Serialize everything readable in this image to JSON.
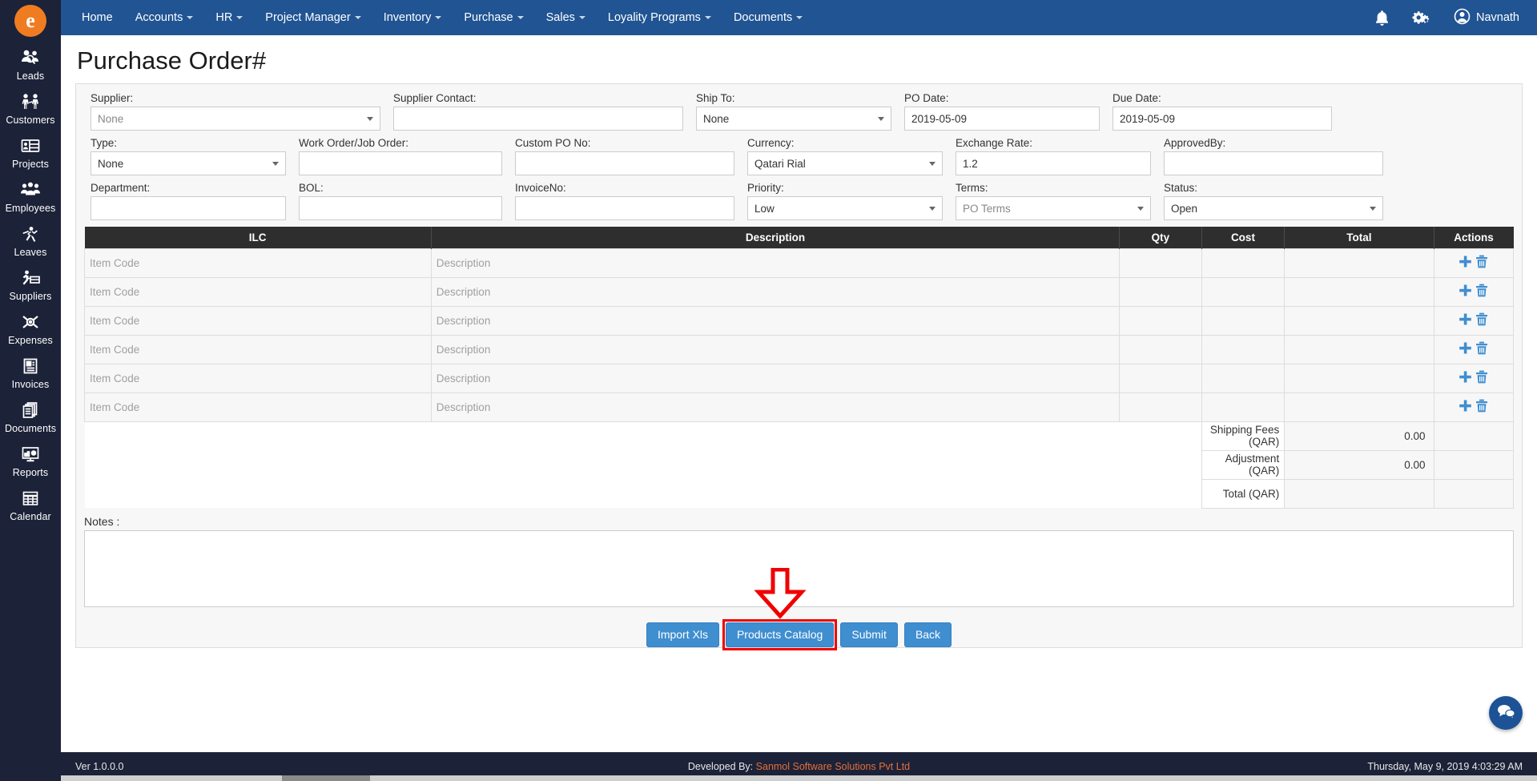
{
  "brand": {
    "logo_letter": "e"
  },
  "topnav": {
    "items": [
      {
        "label": "Home",
        "has_caret": false
      },
      {
        "label": "Accounts",
        "has_caret": true
      },
      {
        "label": "HR",
        "has_caret": true
      },
      {
        "label": "Project Manager",
        "has_caret": true
      },
      {
        "label": "Inventory",
        "has_caret": true
      },
      {
        "label": "Purchase",
        "has_caret": true
      },
      {
        "label": "Sales",
        "has_caret": true
      },
      {
        "label": "Loyality Programs",
        "has_caret": true
      },
      {
        "label": "Documents",
        "has_caret": true
      }
    ],
    "notification_icon": "bell-icon",
    "settings_icon": "gears-icon",
    "user_icon": "user-circle-icon",
    "user_name": "Navnath"
  },
  "sidebar": {
    "items": [
      {
        "label": "Leads",
        "icon": "leads-icon"
      },
      {
        "label": "Customers",
        "icon": "customers-icon"
      },
      {
        "label": "Projects",
        "icon": "projects-icon"
      },
      {
        "label": "Employees",
        "icon": "employees-icon"
      },
      {
        "label": "Leaves",
        "icon": "leaves-icon"
      },
      {
        "label": "Suppliers",
        "icon": "suppliers-icon"
      },
      {
        "label": "Expenses",
        "icon": "expenses-icon"
      },
      {
        "label": "Invoices",
        "icon": "invoices-icon"
      },
      {
        "label": "Documents",
        "icon": "documents-icon"
      },
      {
        "label": "Reports",
        "icon": "reports-icon"
      },
      {
        "label": "Calendar",
        "icon": "calendar-icon"
      }
    ]
  },
  "page": {
    "title": "Purchase Order#"
  },
  "form": {
    "supplier": {
      "label": "Supplier:",
      "value": "None"
    },
    "supplier_contact": {
      "label": "Supplier Contact:",
      "value": ""
    },
    "ship_to": {
      "label": "Ship To:",
      "value": "None"
    },
    "po_date": {
      "label": "PO Date:",
      "value": "2019-05-09"
    },
    "due_date": {
      "label": "Due Date:",
      "value": "2019-05-09"
    },
    "type": {
      "label": "Type:",
      "value": "None"
    },
    "work_order": {
      "label": "Work Order/Job Order:",
      "value": ""
    },
    "custom_po_no": {
      "label": "Custom PO No:",
      "value": ""
    },
    "currency": {
      "label": "Currency:",
      "value": "Qatari Rial"
    },
    "exchange_rate": {
      "label": "Exchange Rate:",
      "value": "1.2"
    },
    "approved_by": {
      "label": "ApprovedBy:",
      "value": ""
    },
    "department": {
      "label": "Department:",
      "value": ""
    },
    "bol": {
      "label": "BOL:",
      "value": ""
    },
    "invoice_no": {
      "label": "InvoiceNo:",
      "value": ""
    },
    "priority": {
      "label": "Priority:",
      "value": "Low"
    },
    "terms": {
      "label": "Terms:",
      "value": "PO Terms"
    },
    "status": {
      "label": "Status:",
      "value": "Open"
    }
  },
  "items_table": {
    "columns": [
      "ILC",
      "Description",
      "Qty",
      "Cost",
      "Total",
      "Actions"
    ],
    "row_placeholders": {
      "ilc": "Item Code",
      "description": "Description"
    },
    "rows": [
      {
        "ilc": "",
        "description": "",
        "qty": "",
        "cost": "",
        "total": ""
      },
      {
        "ilc": "",
        "description": "",
        "qty": "",
        "cost": "",
        "total": ""
      },
      {
        "ilc": "",
        "description": "",
        "qty": "",
        "cost": "",
        "total": ""
      },
      {
        "ilc": "",
        "description": "",
        "qty": "",
        "cost": "",
        "total": ""
      },
      {
        "ilc": "",
        "description": "",
        "qty": "",
        "cost": "",
        "total": ""
      },
      {
        "ilc": "",
        "description": "",
        "qty": "",
        "cost": "",
        "total": ""
      }
    ],
    "row_actions": {
      "add_icon": "plus-icon",
      "delete_icon": "trash-icon"
    },
    "summary": [
      {
        "label": "Shipping Fees (QAR)",
        "value": "0.00"
      },
      {
        "label": "Adjustment (QAR)",
        "value": "0.00"
      },
      {
        "label": "Total (QAR)",
        "value": ""
      }
    ]
  },
  "notes": {
    "label": "Notes :",
    "value": ""
  },
  "buttons": {
    "import_xls": "Import Xls",
    "products_catalog": "Products Catalog",
    "submit": "Submit",
    "back": "Back"
  },
  "annotation": {
    "arrow_color": "#f00000",
    "highlight_target": "Products Catalog"
  },
  "chat": {
    "icon": "chat-bubbles-icon"
  },
  "footer": {
    "version": "Ver 1.0.0.0",
    "developed_prefix": "Developed By:",
    "developed_by": "Sanmol Software Solutions Pvt Ltd",
    "datetime": "Thursday, May 9, 2019 4:03:29 AM"
  },
  "colors": {
    "navbar": "#205493",
    "sidebar": "#1c2238",
    "accent_button": "#3f8ed0",
    "annotation_red": "#f00000",
    "logo_orange": "#f07c22",
    "table_header": "#2e2e2e"
  }
}
